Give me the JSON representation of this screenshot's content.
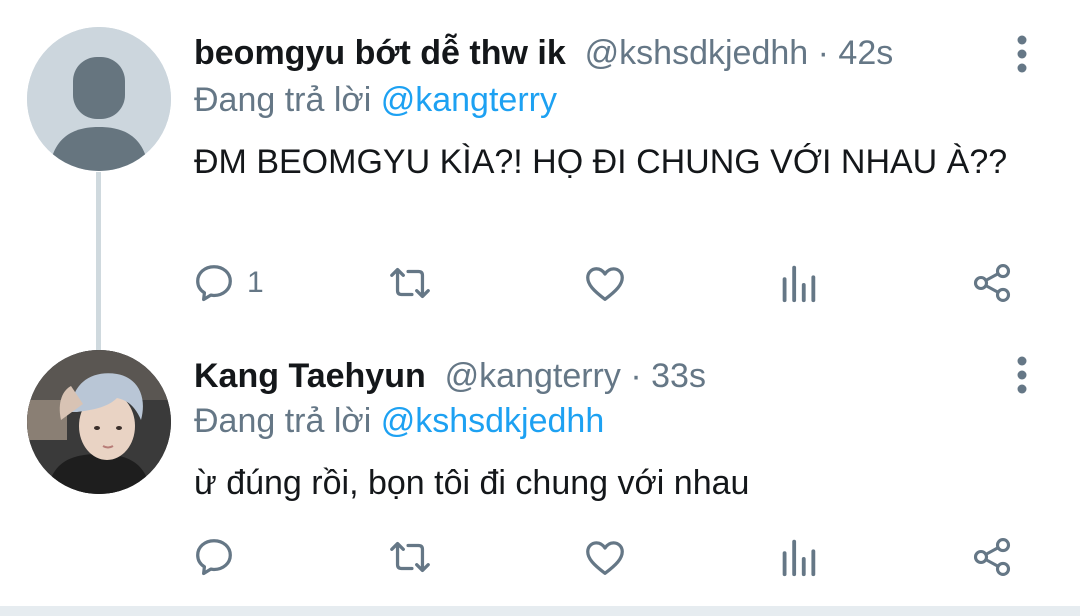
{
  "colors": {
    "accent": "#1da1f2",
    "secondary_text": "#657786",
    "primary_text": "#14171a",
    "thread_line": "#cfd9de"
  },
  "tweets": [
    {
      "display_name": "beomgyu bớt dễ thw ik",
      "handle": "@kshsdkjedhh",
      "separator": "·",
      "time": "42s",
      "reply_prefix": "Đang trả lời",
      "reply_to": "@kangterry",
      "text": "ĐM BEOMGYU KÌA?! HỌ ĐI CHUNG VỚI NHAU À??",
      "reply_count": "1",
      "avatar": "default-avatar",
      "icons": [
        "reply-icon",
        "retweet-icon",
        "like-icon",
        "analytics-icon",
        "share-icon",
        "more-options-icon"
      ]
    },
    {
      "display_name": "Kang Taehyun",
      "handle": "@kangterry",
      "separator": "·",
      "time": "33s",
      "reply_prefix": "Đang trả lời",
      "reply_to": "@kshsdkjedhh",
      "text": "ừ đúng rồi, bọn tôi đi chung với nhau",
      "reply_count": "",
      "avatar": "profile-photo",
      "icons": [
        "reply-icon",
        "retweet-icon",
        "like-icon",
        "analytics-icon",
        "share-icon",
        "more-options-icon"
      ]
    }
  ]
}
